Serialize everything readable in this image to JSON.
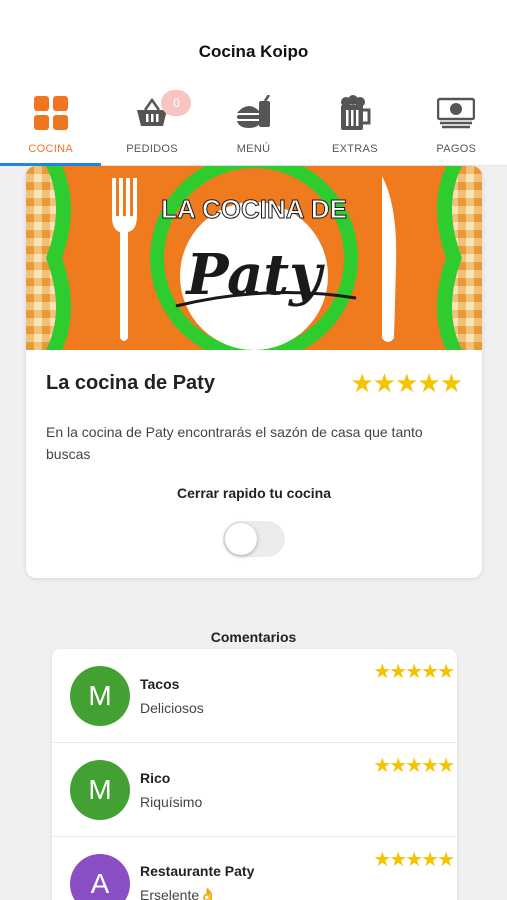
{
  "app": {
    "title": "Cocina Koipo"
  },
  "tabs": [
    {
      "label": "COCINA",
      "icon": "grid-icon",
      "active": true
    },
    {
      "label": "PEDIDOS",
      "icon": "basket-icon",
      "badge": "0"
    },
    {
      "label": "MENÚ",
      "icon": "burger-drink-icon"
    },
    {
      "label": "EXTRAS",
      "icon": "beer-mug-icon"
    },
    {
      "label": "PAGOS",
      "icon": "money-icon"
    }
  ],
  "restaurant": {
    "banner_top_text": "LA COCINA DE",
    "banner_script_text": "Paty",
    "name": "La cocina de Paty",
    "rating": 5,
    "stars": "★★★★★",
    "description": "En la cocina de Paty encontrarás el sazón de casa que tanto buscas",
    "close_label": "Cerrar rapido tu cocina",
    "close_toggle_on": false
  },
  "comments": {
    "title": "Comentarios",
    "items": [
      {
        "initial": "M",
        "title": "Tacos",
        "body": "Deliciosos",
        "rating": 5,
        "stars": "★★★★★",
        "avatar_color": "#43a033"
      },
      {
        "initial": "M",
        "title": "Rico",
        "body": "Riquísimo",
        "rating": 5,
        "stars": "★★★★★",
        "avatar_color": "#43a033"
      },
      {
        "initial": "A",
        "title": "Restaurante Paty",
        "body": "Erselente👌",
        "rating": 5,
        "stars": "★★★★★",
        "avatar_color": "#8a4fc4"
      }
    ]
  },
  "colors": {
    "accent": "#f07521",
    "indicator": "#1e88e5",
    "star": "#f5c400"
  }
}
